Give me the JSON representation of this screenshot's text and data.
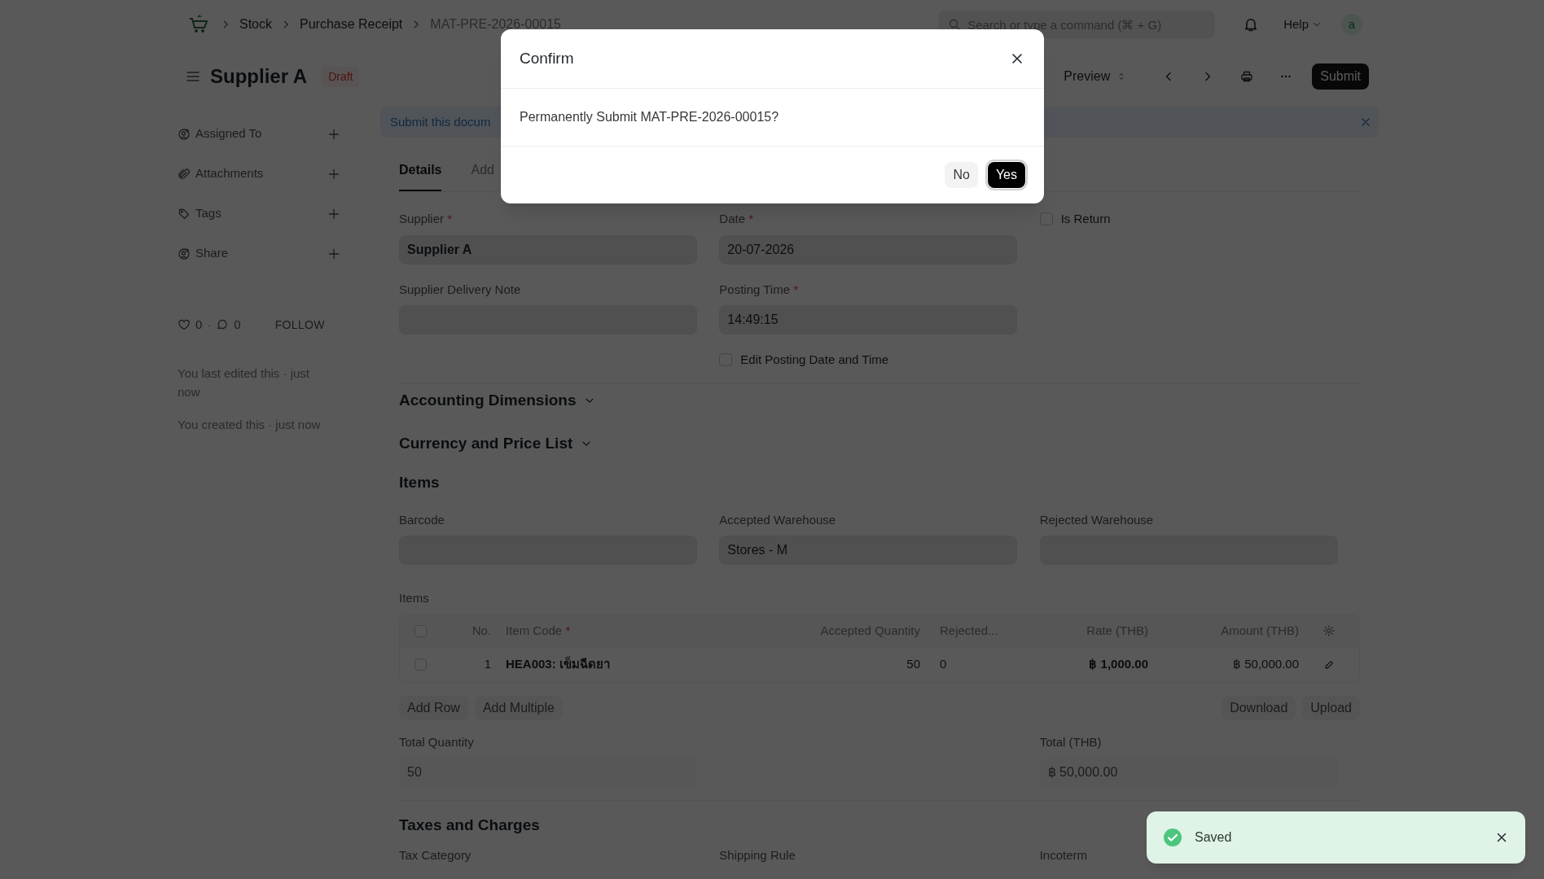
{
  "topbar": {
    "breadcrumbs": [
      "Stock",
      "Purchase Receipt",
      "MAT-PRE-2026-00015"
    ],
    "search": {
      "placeholder": "Search or type a command (⌘ + G)"
    },
    "help": "Help",
    "avatar": "a"
  },
  "header": {
    "title": "Supplier A",
    "status": "Draft",
    "preview": "Preview",
    "submit": "Submit"
  },
  "sidebar": {
    "items": [
      {
        "label": "Assigned To",
        "kind": "user"
      },
      {
        "label": "Attachments",
        "kind": "clip"
      },
      {
        "label": "Tags",
        "kind": "tag"
      },
      {
        "label": "Share",
        "kind": "user"
      }
    ],
    "likes": "0",
    "separator": "·",
    "comments": "0",
    "follow": "FOLLOW",
    "activity": [
      "You last edited this · just now",
      "You created this · just now"
    ]
  },
  "banner": {
    "text": "Submit this docum"
  },
  "tabs": [
    {
      "label": "Details",
      "selected": true
    },
    {
      "label": "Add",
      "selected": false
    }
  ],
  "details": {
    "columns": [
      [
        {
          "kind": "input",
          "label": "Supplier",
          "mark": "*",
          "value": "Supplier A",
          "bold": true
        },
        {
          "kind": "input",
          "label": "Supplier Delivery Note"
        }
      ],
      [
        {
          "kind": "input",
          "label": "Date",
          "mark": "*",
          "value": "20-07-2026"
        },
        {
          "kind": "input",
          "label": "Posting Time",
          "mark": "*",
          "value": "14:49:15"
        },
        {
          "kind": "checkbox",
          "label": "Edit Posting Date and Time",
          "checked": false
        }
      ],
      [
        {
          "kind": "checkbox",
          "label": "Is Return",
          "checked": false
        }
      ]
    ]
  },
  "collapsibles": [
    {
      "title": "Accounting Dimensions",
      "expanded": false
    },
    {
      "title": "Currency and Price List",
      "expanded": false
    }
  ],
  "items_section": {
    "title": "Items",
    "columns": [
      [
        {
          "kind": "input",
          "label": "Barcode"
        }
      ],
      [
        {
          "kind": "input",
          "label": "Accepted Warehouse",
          "value": "Stores - M"
        }
      ],
      [
        {
          "kind": "input",
          "label": "Rejected Warehouse"
        }
      ]
    ],
    "table": {
      "label": "Items",
      "columns": [
        "No.",
        "Item Code",
        "Accepted Quantity",
        "Rejected...",
        "Rate (THB)",
        "Amount (THB)"
      ],
      "required_mark": "*",
      "select_all_checked": false,
      "rows": [
        {
          "checked": false,
          "cells": [
            "1",
            "HEA003: เข็มฉีดยา",
            "50",
            "0",
            "฿ 1,000.00",
            "฿ 50,000.00"
          ]
        }
      ]
    },
    "left_buttons": [
      "Add Row",
      "Add Multiple"
    ],
    "right_buttons": [
      "Download",
      "Upload"
    ],
    "totals": [
      {
        "label": "Total Quantity",
        "value": "50"
      },
      {
        "label": "Total (THB)",
        "value": "฿ 50,000.00"
      }
    ]
  },
  "taxes_section": {
    "title": "Taxes and Charges",
    "labels": [
      "Tax Category",
      "Shipping Rule",
      "Incoterm"
    ]
  },
  "dialog": {
    "title": "Confirm",
    "message": "Permanently Submit MAT-PRE-2026-00015?",
    "buttons": [
      {
        "label": "No",
        "primary": false
      },
      {
        "label": "Yes",
        "primary": true
      }
    ]
  },
  "toast": {
    "message": "Saved"
  }
}
